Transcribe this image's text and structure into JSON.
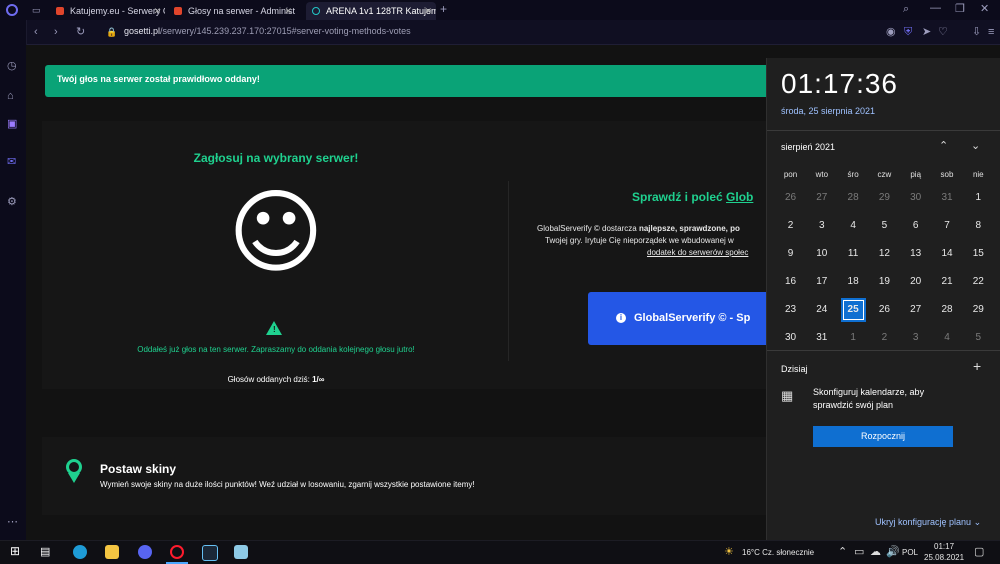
{
  "tabs": [
    {
      "label": "Katujemy.eu - Serwery CS",
      "color": "#e0452b",
      "active": false
    },
    {
      "label": "Głosy na serwer - Administ",
      "color": "#e0452b",
      "active": false
    },
    {
      "label": "ARENA 1v1 128TR Katujem",
      "color": "#22c7c7",
      "active": true
    }
  ],
  "address": {
    "domain": "gosetti.pl",
    "path": "/serwery/145.239.237.170:27015#server-voting-methods-votes"
  },
  "page": {
    "alert": "Twój głos na serwer został prawidłowo oddany!",
    "vote": {
      "title": "Zagłosuj na wybrany serwer!",
      "smiley": "☺",
      "already_voted": "Oddałeś już głos na ten serwer. Zapraszamy do oddania kolejnego głosu jutro!",
      "votes_today_label": "Głosów oddanych dziś:",
      "votes_today_value": "1/∞"
    },
    "verify": {
      "title_plain": "Sprawdź i poleć",
      "title_link": "Glob",
      "desc_prefix": "GlobalServerify © dostarcza",
      "desc_bold": "najlepsze, sprawdzone, po",
      "desc_line2": "Twojej gry. Irytuje Cię nieporządek we wbudowanej w",
      "desc_link": "dodatek do serwerów społec",
      "button": "GlobalServerify © - Sp"
    },
    "skins": {
      "title": "Postaw skiny",
      "desc": "Wymień swoje skiny na duże ilości punktów! Weź udział w losowaniu, zgarnij wszystkie postawione itemy!"
    }
  },
  "calendar": {
    "time": "01:17:36",
    "date": "środa, 25 sierpnia 2021",
    "month": "sierpień 2021",
    "weekdays": [
      "pon",
      "wto",
      "śro",
      "czw",
      "pią",
      "sob",
      "nie"
    ],
    "days": [
      {
        "d": "26",
        "dim": true
      },
      {
        "d": "27",
        "dim": true
      },
      {
        "d": "28",
        "dim": true
      },
      {
        "d": "29",
        "dim": true
      },
      {
        "d": "30",
        "dim": true
      },
      {
        "d": "31",
        "dim": true
      },
      {
        "d": "1"
      },
      {
        "d": "2"
      },
      {
        "d": "3"
      },
      {
        "d": "4"
      },
      {
        "d": "5"
      },
      {
        "d": "6"
      },
      {
        "d": "7"
      },
      {
        "d": "8"
      },
      {
        "d": "9"
      },
      {
        "d": "10"
      },
      {
        "d": "11"
      },
      {
        "d": "12"
      },
      {
        "d": "13"
      },
      {
        "d": "14"
      },
      {
        "d": "15"
      },
      {
        "d": "16"
      },
      {
        "d": "17"
      },
      {
        "d": "18"
      },
      {
        "d": "19"
      },
      {
        "d": "20"
      },
      {
        "d": "21"
      },
      {
        "d": "22"
      },
      {
        "d": "23"
      },
      {
        "d": "24"
      },
      {
        "d": "25",
        "today": true
      },
      {
        "d": "26"
      },
      {
        "d": "27"
      },
      {
        "d": "28"
      },
      {
        "d": "29"
      },
      {
        "d": "30"
      },
      {
        "d": "31"
      },
      {
        "d": "1",
        "dim": true
      },
      {
        "d": "2",
        "dim": true
      },
      {
        "d": "3",
        "dim": true
      },
      {
        "d": "4",
        "dim": true
      },
      {
        "d": "5",
        "dim": true
      }
    ],
    "agenda_title": "Dzisiaj",
    "agenda_text": "Skonfiguruj kalendarze, aby sprawdzić swój plan",
    "start_button": "Rozpocznij",
    "hide_link": "Ukryj konfigurację planu"
  },
  "taskbar": {
    "weather": "16°C  Cz. słonecznie",
    "lang": "POL",
    "time": "01:17",
    "date": "25.08.2021"
  },
  "colors": {
    "accent": "#0aa377",
    "button_blue": "#2457e6",
    "calendar_today": "#0f6fd1"
  }
}
